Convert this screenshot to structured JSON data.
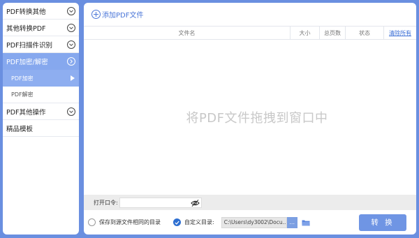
{
  "sidebar": {
    "items": [
      {
        "label": "PDF转换其他"
      },
      {
        "label": "其他转换PDF"
      },
      {
        "label": "PDF扫描件识别"
      },
      {
        "label": "PDF加密/解密"
      },
      {
        "label": "PDF其他操作"
      },
      {
        "label": "精品模板"
      }
    ],
    "subitems": [
      {
        "label": "PDF加密"
      },
      {
        "label": "PDF解密"
      }
    ]
  },
  "toolbar": {
    "add_label": "添加PDF文件"
  },
  "table": {
    "columns": [
      "文件名",
      "大小",
      "总页数",
      "状态"
    ],
    "clear_label": "清除所有"
  },
  "dropzone": {
    "text": "将PDF文件拖拽到窗口中"
  },
  "password": {
    "label": "打开口令:",
    "value": ""
  },
  "output": {
    "same_dir_label": "保存到源文件相同的目录",
    "custom_dir_label": "自定义目录:",
    "path": "C:\\Users\\dy3002\\Docu...",
    "browse_label": "..."
  },
  "convert_label": "转 换",
  "colors": {
    "accent": "#6a8fe0",
    "active": "#86a8ee",
    "link": "#3b6fd6"
  }
}
